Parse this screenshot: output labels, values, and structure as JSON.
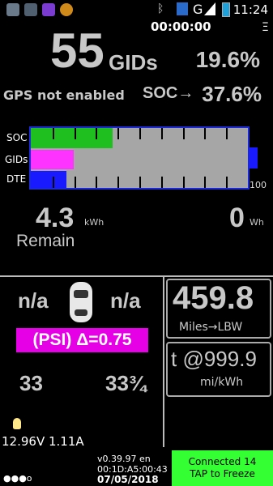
{
  "status_bar": {
    "time": "11:24",
    "left_icons": [
      "image-icon",
      "photo-icon",
      "notes-icon",
      "maps-icon"
    ],
    "right_icons": [
      "bluetooth-icon",
      "nfc-icon",
      "signal-icon",
      "battery-icon"
    ],
    "network": "G"
  },
  "header": {
    "elapsed": "00:00:00",
    "menu_glyph": "Ξ"
  },
  "gids": {
    "value": "55",
    "unit": "GIDs",
    "percent": "19.6%"
  },
  "gps": {
    "text": "GPS not enabled"
  },
  "soc": {
    "label": "SOC→",
    "value": "37.6%"
  },
  "bars": {
    "labels": [
      "SOC",
      "GIDs",
      "DTE"
    ],
    "scale_max": "100",
    "soc_fraction": 0.376,
    "gids_fraction": 0.196,
    "dte_fraction": 0.165,
    "colors": {
      "soc": "#1fbf1f",
      "gids": "#ff33ff",
      "dte": "#1a1aff",
      "bg": "#a6a6a6",
      "border": "#1a2ad8"
    }
  },
  "energy": {
    "remain_value": "4.3",
    "remain_unit": "kWh",
    "remain_label": "Remain",
    "used_value": "0",
    "used_unit": "Wh"
  },
  "tires": {
    "left": "n/a",
    "right": "n/a",
    "psi_delta": "(PSI) Δ=0.75",
    "bottom_left": "33",
    "bottom_right": "33¾"
  },
  "right_panel": {
    "range_value": "459.8",
    "range_label": "Miles→LBW",
    "efficiency_value": "t @999.9",
    "efficiency_label": "mi/kWh"
  },
  "battery12v": {
    "text": "12.96V 1.11A"
  },
  "footer": {
    "version": "v0.39.97 en",
    "mac": "00:1D:A5:00:43",
    "date": "07/05/2018",
    "connected": "Connected 14",
    "tap": "TAP to Freeze",
    "dots": "●●●o"
  }
}
